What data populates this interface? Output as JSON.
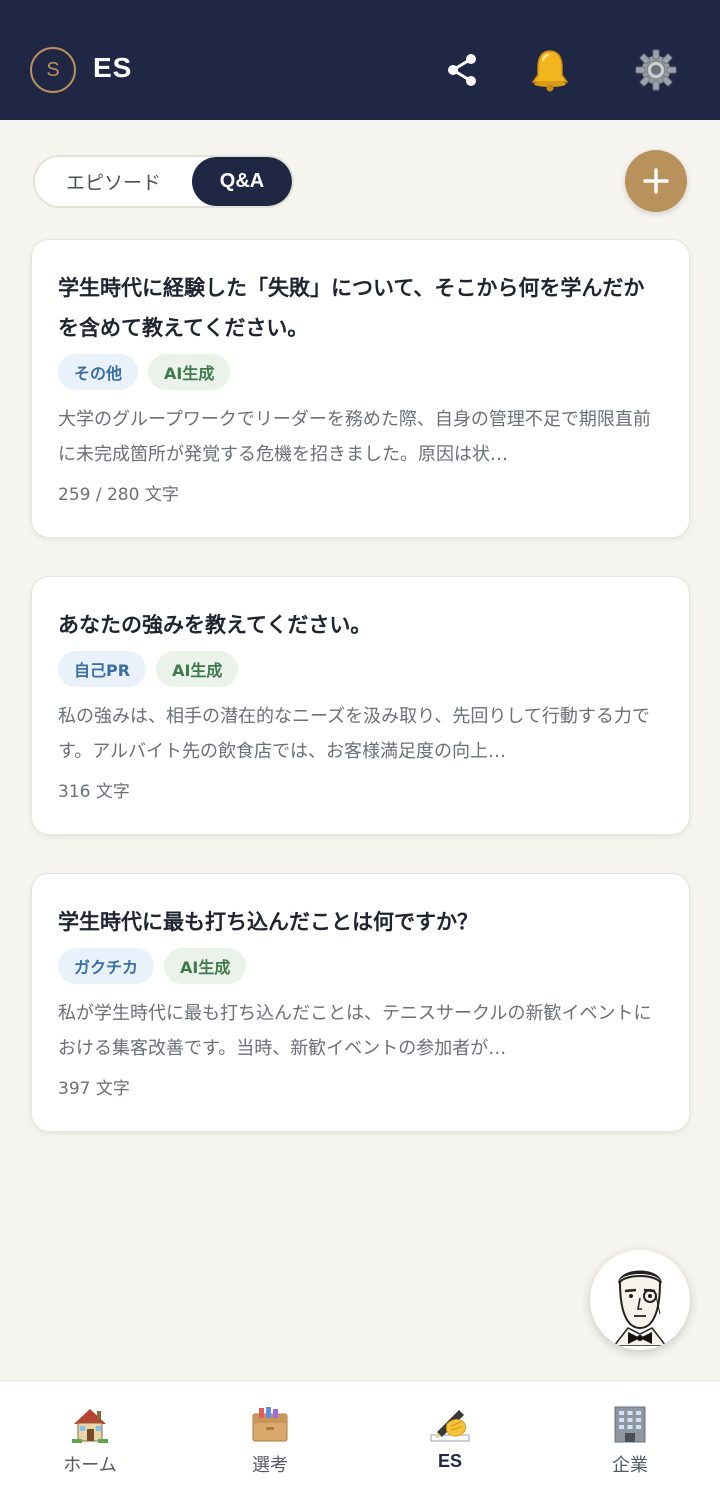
{
  "header": {
    "logo_letter": "S",
    "title": "ES",
    "icons": [
      "share-icon",
      "bell-icon",
      "gear-icon"
    ]
  },
  "segmented": {
    "options": [
      "エピソード",
      "Q&A"
    ],
    "selected": "Q&A"
  },
  "add_button": {
    "icon": "plus-icon"
  },
  "cards": [
    {
      "title": "学生時代に経験した「失敗」について、そこから何を学んだかを含めて教えてください。",
      "category": "その他",
      "ai_tag": "AI生成",
      "preview": "大学のグループワークでリーダーを務めた際、自身の管理不足で期限直前に未完成箇所が発覚する危機を招きました。原因は状…",
      "count": "259 / 280 文字"
    },
    {
      "title": "あなたの強みを教えてください。",
      "category": "自己PR",
      "ai_tag": "AI生成",
      "preview": "私の強みは、相手の潜在的なニーズを汲み取り、先回りして行動する力です。アルバイト先の飲食店では、お客様満足度の向上…",
      "count": "316 文字"
    },
    {
      "title": "学生時代に最も打ち込んだことは何ですか？",
      "category": "ガクチカ",
      "ai_tag": "AI生成",
      "preview": "私が学生時代に最も打ち込んだことは、テニスサークルの新歓イベントにおける集客改善です。当時、新歓イベントの参加者が…",
      "count": "397 文字"
    }
  ],
  "nav": [
    {
      "label": "ホーム",
      "icon": "house-icon"
    },
    {
      "label": "選考",
      "icon": "file-box-icon"
    },
    {
      "label": "ES",
      "icon": "writing-hand-icon",
      "active": true
    },
    {
      "label": "企業",
      "icon": "office-building-icon"
    }
  ],
  "colors": {
    "header_bg": "#1f2744",
    "accent_gold": "#b8925a",
    "page_bg": "#f5f4ef"
  }
}
